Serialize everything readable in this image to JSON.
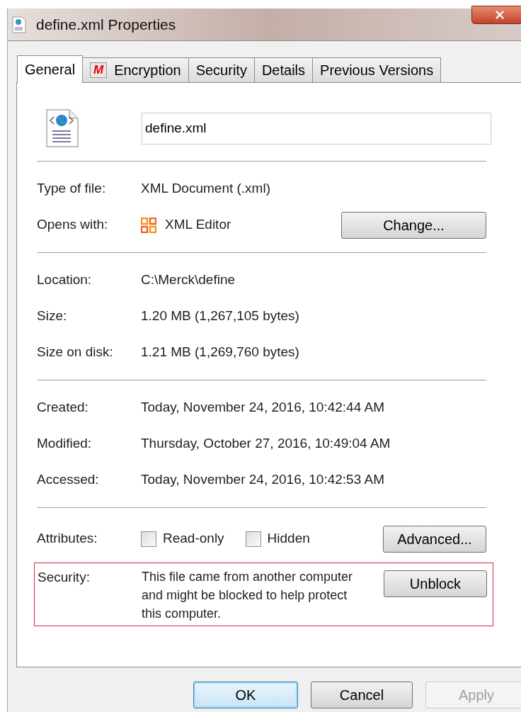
{
  "window": {
    "title": "define.xml Properties"
  },
  "tabs": [
    {
      "label": "General",
      "selected": true
    },
    {
      "label": "Encryption",
      "selected": false,
      "badge": "M"
    },
    {
      "label": "Security",
      "selected": false
    },
    {
      "label": "Details",
      "selected": false
    },
    {
      "label": "Previous Versions",
      "selected": false
    }
  ],
  "file_name": {
    "value": "define.xml"
  },
  "sections": [
    [
      {
        "label": "Type of file:",
        "value": "XML Document (.xml)"
      },
      {
        "label": "Opens with:",
        "value": "XML Editor",
        "kind": "app",
        "button": "Change..."
      }
    ],
    [
      {
        "label": "Location:",
        "value": "C:\\Merck\\define"
      },
      {
        "label": "Size:",
        "value": "1.20 MB (1,267,105 bytes)"
      },
      {
        "label": "Size on disk:",
        "value": "1.21 MB (1,269,760 bytes)"
      }
    ],
    [
      {
        "label": "Created:",
        "value": "Today, November 24, 2016, 10:42:44 AM"
      },
      {
        "label": "Modified:",
        "value": "Thursday, October 27, 2016, 10:49:04 AM"
      },
      {
        "label": "Accessed:",
        "value": "Today, November 24, 2016, 10:42:53 AM"
      }
    ]
  ],
  "attributes": {
    "label": "Attributes:",
    "checkboxes": [
      {
        "label": "Read-only",
        "checked": false
      },
      {
        "label": "Hidden",
        "checked": false
      }
    ],
    "button": "Advanced..."
  },
  "security": {
    "label": "Security:",
    "text": "This file came from another computer and might be blocked to help protect this computer.",
    "button": "Unblock",
    "highlighted": true
  },
  "buttons": [
    {
      "label": "OK",
      "default": true,
      "disabled": false
    },
    {
      "label": "Cancel",
      "default": false,
      "disabled": false
    },
    {
      "label": "Apply",
      "default": false,
      "disabled": true
    }
  ]
}
